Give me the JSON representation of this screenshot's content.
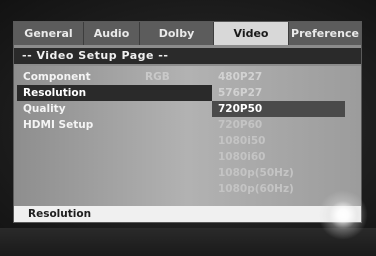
{
  "tabs": [
    {
      "label": "General"
    },
    {
      "label": "Audio"
    },
    {
      "label": "Dolby"
    },
    {
      "label": "Video",
      "active": true
    },
    {
      "label": "Preference"
    }
  ],
  "page_title": "-- Video Setup Page --",
  "menu": [
    {
      "label": "Component",
      "value": "RGB"
    },
    {
      "label": "Resolution",
      "selected": true
    },
    {
      "label": "Quality"
    },
    {
      "label": "HDMI Setup"
    }
  ],
  "options": [
    {
      "label": "480P27"
    },
    {
      "label": "576P27"
    },
    {
      "label": "720P50",
      "current": true
    },
    {
      "label": "720P60"
    },
    {
      "label": "1080i50"
    },
    {
      "label": "1080i60"
    },
    {
      "label": "1080p(50Hz)"
    },
    {
      "label": "1080p(60Hz)"
    }
  ],
  "footer": {
    "label": "Resolution"
  },
  "colors": {
    "osd_bg": "#8c8c8c",
    "tab_bar": "#5c5c5c",
    "active_tab": "#d8d8d8",
    "selection": "#2a2a2a"
  }
}
